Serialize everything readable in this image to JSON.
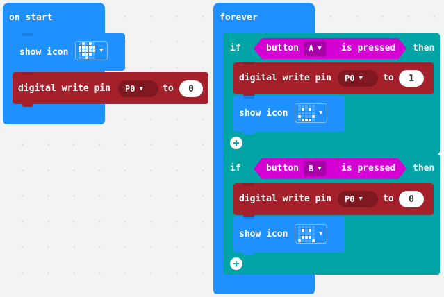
{
  "on_start": {
    "hat_label": "on start",
    "show_icon_label": "show icon",
    "icon_name": "heart-icon",
    "write_label": "digital write pin",
    "pin": "P0",
    "to_label": "to",
    "value": "0"
  },
  "forever": {
    "hat_label": "forever",
    "if1": {
      "if_label": "if",
      "button_label": "button",
      "button": "A",
      "pressed_label": "is pressed",
      "then_label": "then",
      "write_label": "digital write pin",
      "pin": "P0",
      "to_label": "to",
      "value": "1",
      "show_icon_label": "show icon",
      "icon_name": "happy-face-icon"
    },
    "if2": {
      "if_label": "if",
      "button_label": "button",
      "button": "B",
      "pressed_label": "is pressed",
      "then_label": "then",
      "write_label": "digital write pin",
      "pin": "P0",
      "to_label": "to",
      "value": "0",
      "show_icon_label": "show icon",
      "icon_name": "sad-face-icon"
    }
  },
  "colors": {
    "basic": "#1e90ff",
    "pins": "#a4212b",
    "logic": "#00a4a6",
    "input": "#d400d4",
    "workspace": "#f3f3f3"
  }
}
